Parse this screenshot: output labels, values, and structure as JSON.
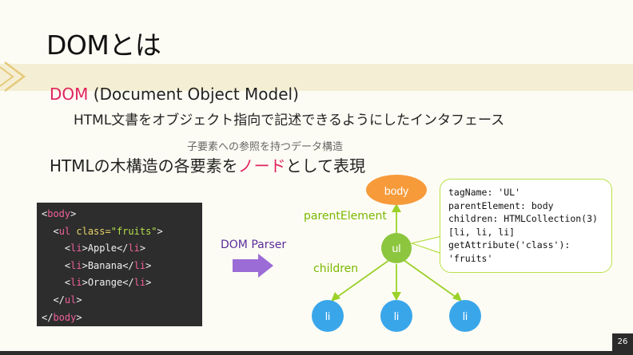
{
  "slide": {
    "title": "DOMとは",
    "dom_term": "DOM",
    "dom_expansion": " (Document Object Model)",
    "dom_description": "HTML文書をオブジェクト指向で記述できるようにしたインタフェース",
    "annotation": "子要素への参照を持つデータ構造",
    "node_line_prefix": "HTMLの木構造の各要素を",
    "node_line_accent": "ノード",
    "node_line_suffix": "として表現",
    "page_number": "26"
  },
  "code": {
    "lines": [
      {
        "indent": "",
        "open": "<",
        "tag": "body",
        "attr": "",
        "val": "",
        "close": ">",
        "text": "",
        "end": ""
      },
      {
        "indent": "  ",
        "open": "<",
        "tag": "ul",
        "attr": " class=",
        "val": "\"fruits\"",
        "close": ">",
        "text": "",
        "end": ""
      },
      {
        "indent": "    ",
        "open": "<",
        "tag": "li",
        "attr": "",
        "val": "",
        "close": ">",
        "text": "Apple",
        "end": "li"
      },
      {
        "indent": "    ",
        "open": "<",
        "tag": "li",
        "attr": "",
        "val": "",
        "close": ">",
        "text": "Banana",
        "end": "li"
      },
      {
        "indent": "    ",
        "open": "<",
        "tag": "li",
        "attr": "",
        "val": "",
        "close": ">",
        "text": "Orange",
        "end": "li"
      },
      {
        "indent": "  ",
        "open": "</",
        "tag": "ul",
        "attr": "",
        "val": "",
        "close": ">",
        "text": "",
        "end": ""
      },
      {
        "indent": "",
        "open": "</",
        "tag": "body",
        "attr": "",
        "val": "",
        "close": ">",
        "text": "",
        "end": ""
      }
    ]
  },
  "diagram": {
    "parser_label": "DOM Parser",
    "parent_label": "parentElement",
    "children_label": "children",
    "nodes": {
      "body": "body",
      "ul": "ul",
      "li1": "li",
      "li2": "li",
      "li3": "li"
    },
    "colors": {
      "body": "#f79a3a",
      "ul": "#8cc63f",
      "li": "#3aa6ea",
      "edge": "#9bd12a",
      "arrow": "#9b6bd6",
      "accent": "#e0245e"
    }
  },
  "info_box": {
    "text": "tagName: 'UL'\nparentElement: body\nchildren: HTMLCollection(3)\n[li, li, li]\ngetAttribute('class'):\n'fruits'"
  }
}
